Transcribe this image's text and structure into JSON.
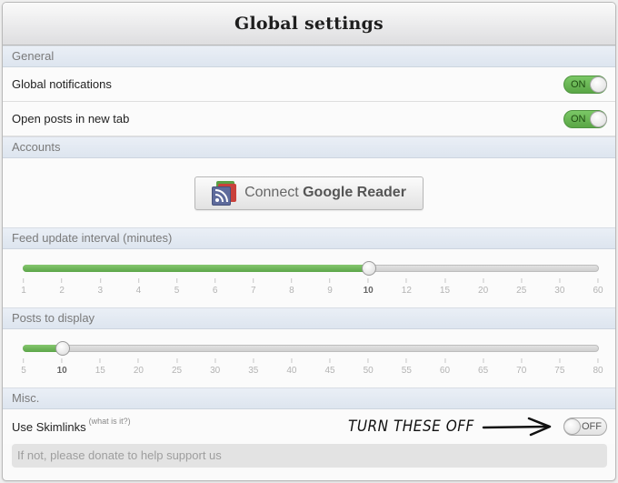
{
  "header": {
    "title": "Global settings"
  },
  "sections": {
    "general": {
      "title": "General",
      "rows": [
        {
          "label": "Global notifications",
          "toggle": "ON",
          "state": true
        },
        {
          "label": "Open posts in new tab",
          "toggle": "ON",
          "state": true
        }
      ]
    },
    "accounts": {
      "title": "Accounts",
      "connect_prefix": "Connect",
      "connect_service": "Google Reader",
      "icon": "rss-feed-icon"
    },
    "feed_interval": {
      "title": "Feed update interval (minutes)",
      "ticks": [
        "1",
        "2",
        "3",
        "4",
        "5",
        "6",
        "7",
        "8",
        "9",
        "10",
        "12",
        "15",
        "20",
        "25",
        "30",
        "60"
      ],
      "selected": "10",
      "selected_index": 9
    },
    "posts": {
      "title": "Posts to display",
      "ticks": [
        "5",
        "10",
        "15",
        "20",
        "25",
        "30",
        "35",
        "40",
        "45",
        "50",
        "55",
        "60",
        "65",
        "70",
        "75",
        "80"
      ],
      "selected": "10",
      "selected_index": 1
    },
    "misc": {
      "title": "Misc.",
      "skimlinks_label": "Use Skimlinks",
      "what_link": "(what is it?)",
      "annotation": "TURN THESE OFF",
      "toggle": "OFF",
      "state": false,
      "donate_placeholder": "If not, please donate to help support us"
    }
  },
  "colors": {
    "accent_on": "#6bb857",
    "section_bg": "#e3e9f1"
  }
}
